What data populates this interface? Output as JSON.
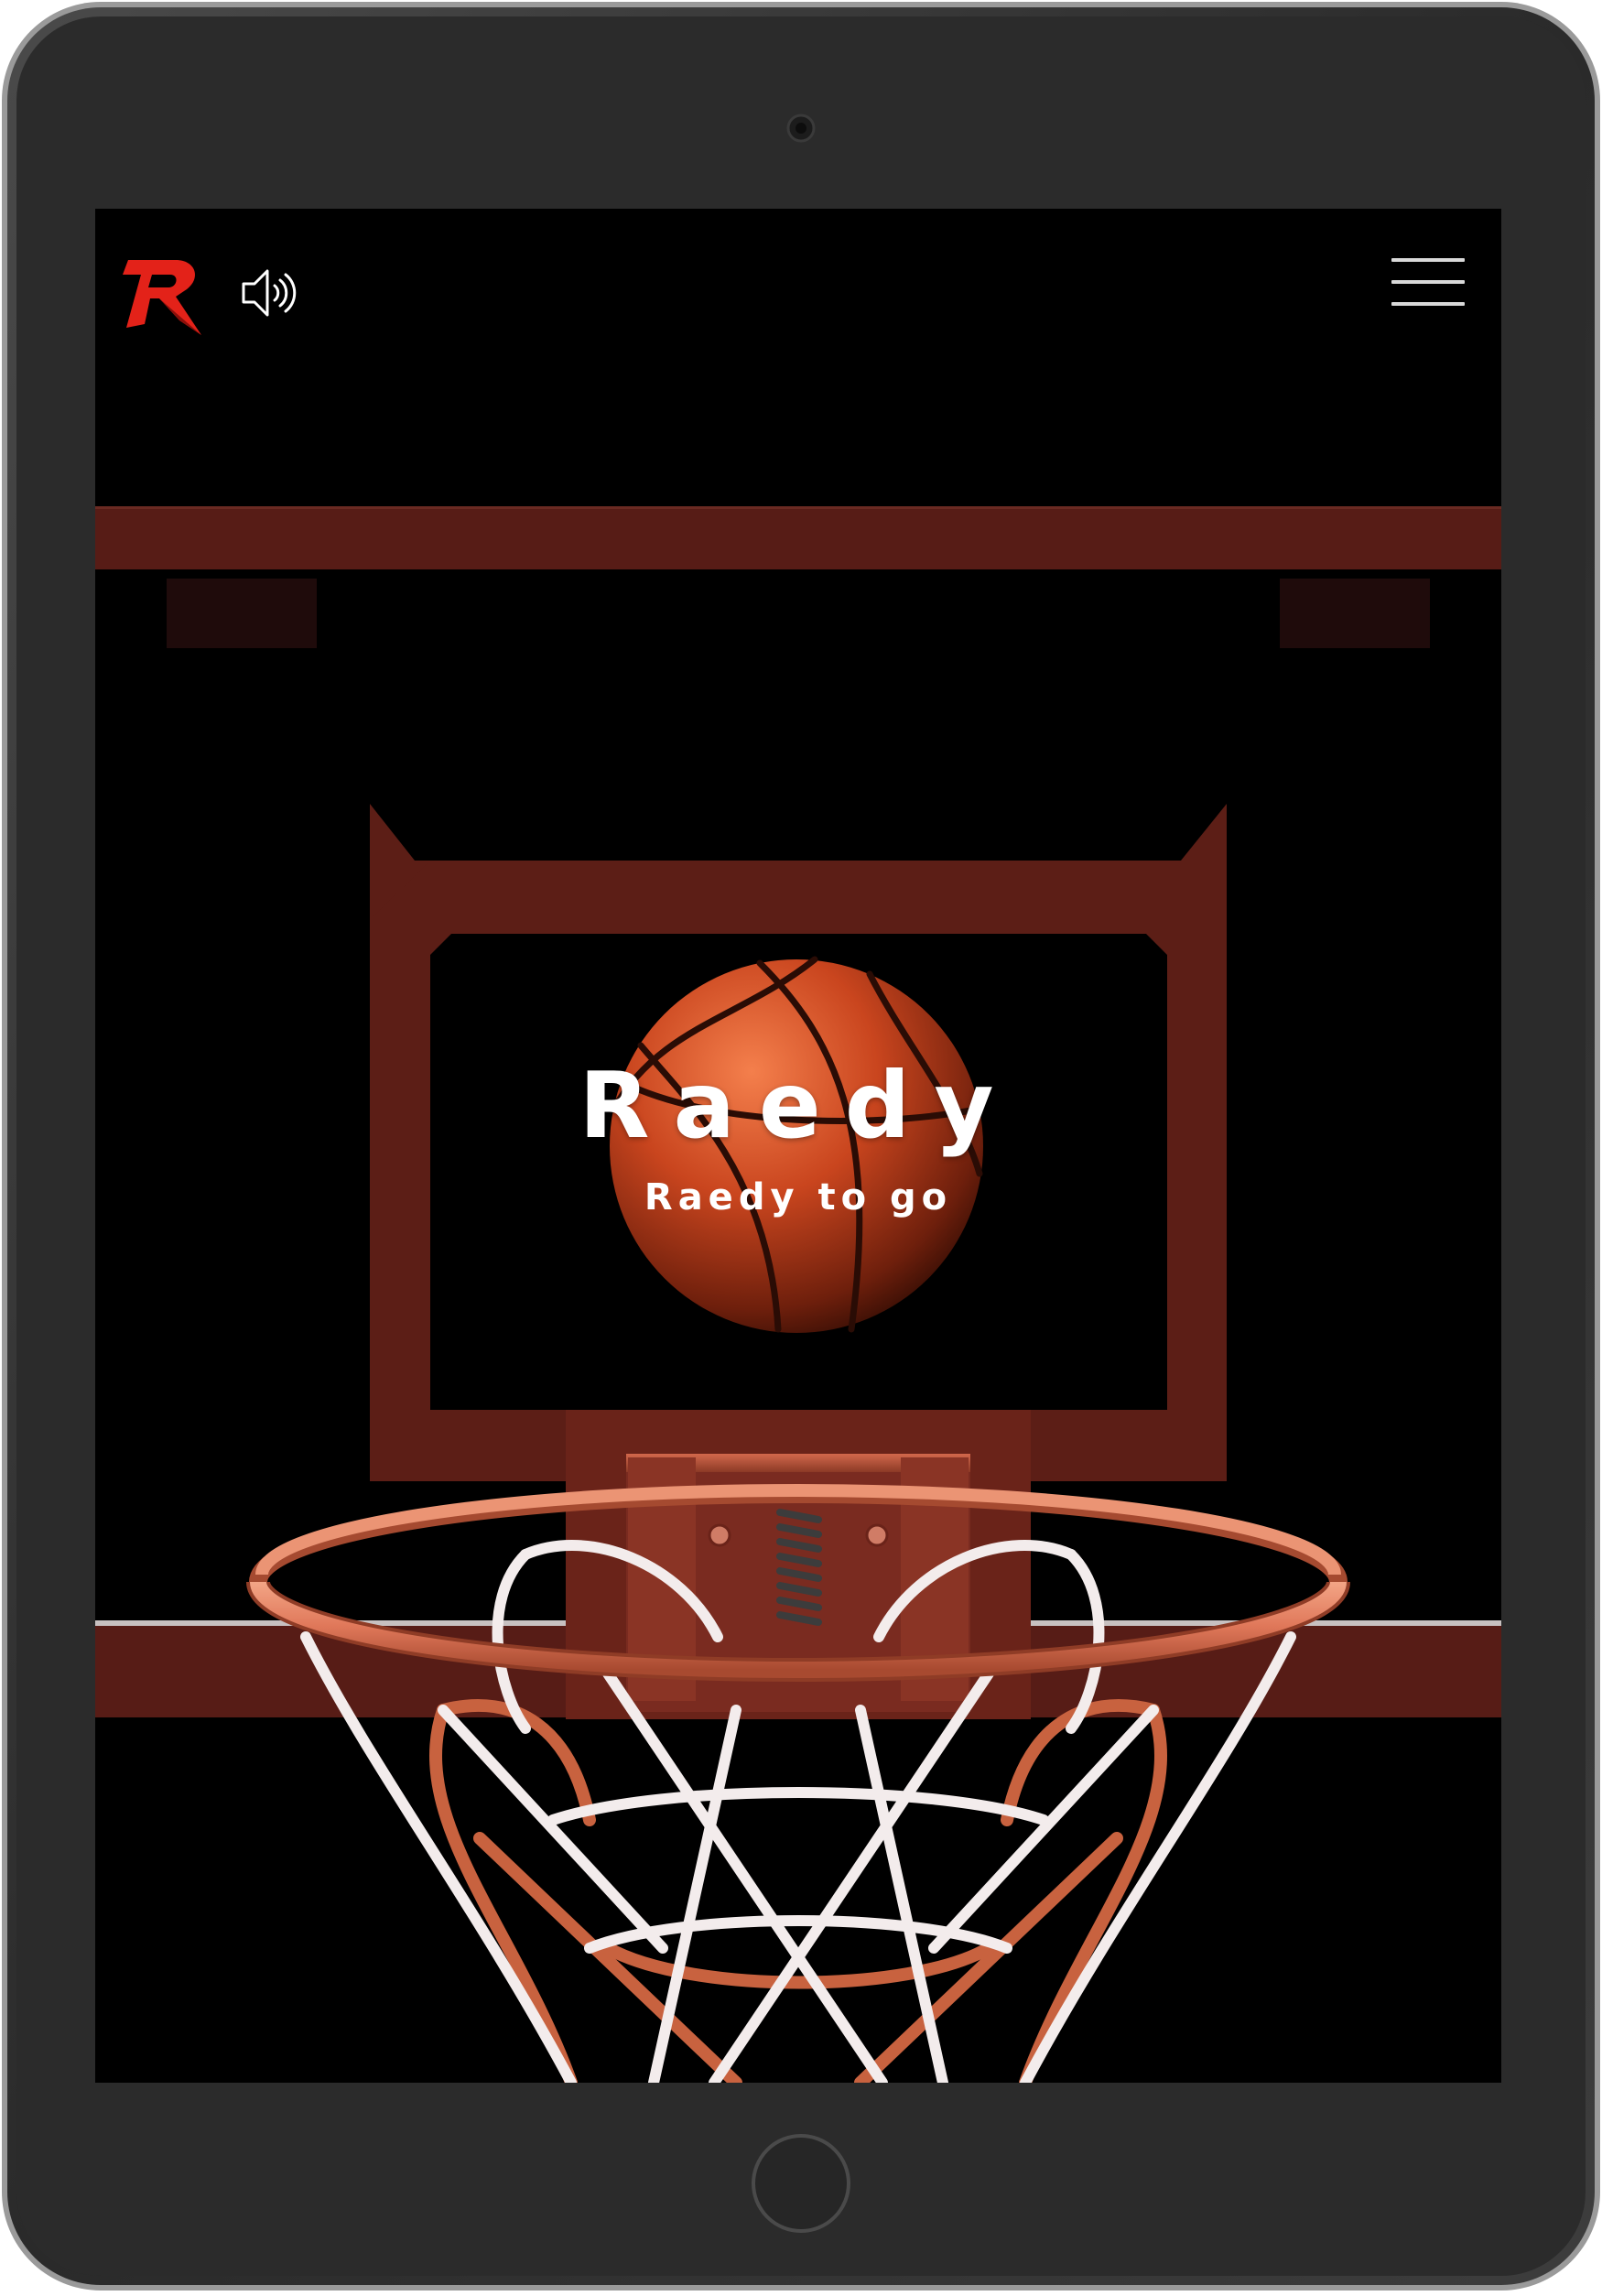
{
  "header": {
    "logo_icon": "raedy-r-logo",
    "sound_icon": "speaker-volume-icon",
    "menu_icon": "hamburger-menu-icon"
  },
  "hero": {
    "title": "Raedy",
    "subtitle": "Raedy to go"
  },
  "colors": {
    "background": "#000000",
    "backboard": "#5a1f18",
    "brand_red": "#e32219",
    "rim": "#e0785a",
    "net": "#f3ecec"
  }
}
